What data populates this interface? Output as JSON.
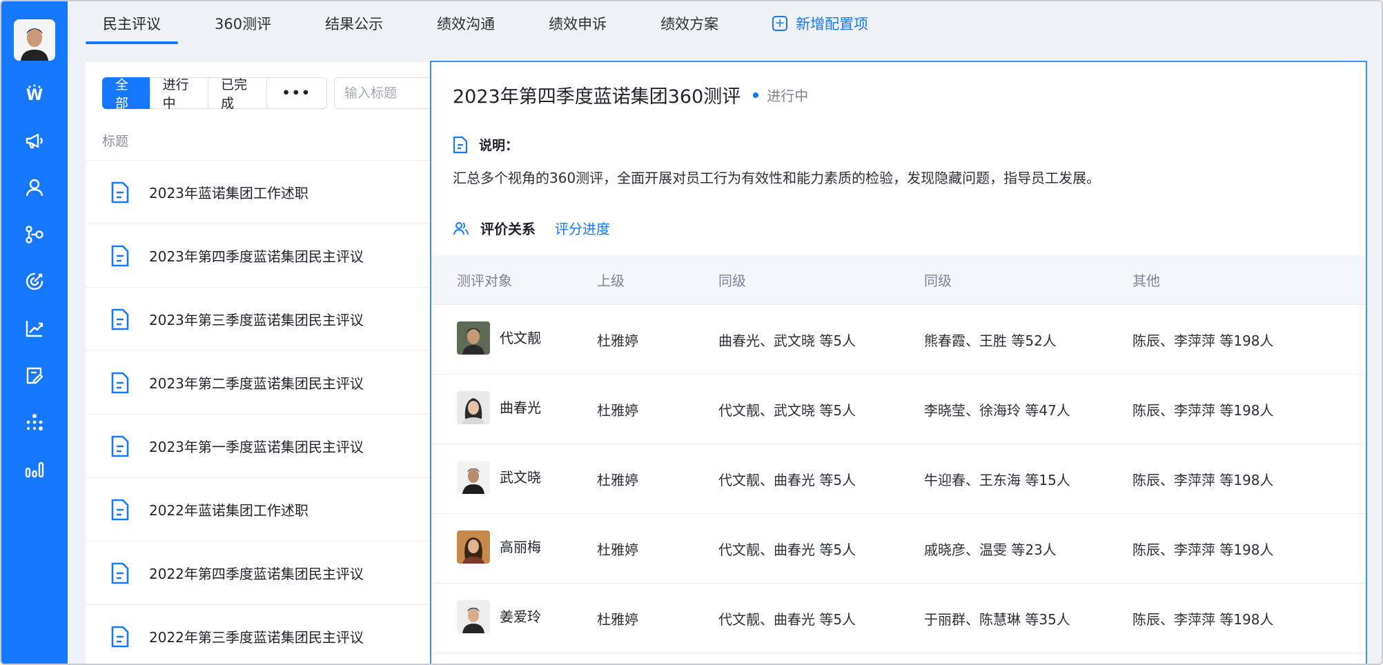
{
  "tabs": [
    {
      "label": "民主评议"
    },
    {
      "label": "360测评"
    },
    {
      "label": "结果公示"
    },
    {
      "label": "绩效沟通"
    },
    {
      "label": "绩效申诉"
    },
    {
      "label": "绩效方案"
    }
  ],
  "add_tab_label": "新增配置项",
  "accent_color": "#1677ff",
  "rail": {
    "icons": [
      "avatar",
      "wordmark-icon",
      "megaphone-icon",
      "user-icon",
      "org-chart-icon",
      "target-icon",
      "trend-chart-icon",
      "doc-edit-icon",
      "dots-network-icon",
      "bar-chart-icon"
    ]
  },
  "filter": {
    "all": "全部",
    "in_progress": "进行中",
    "done": "已完成",
    "more": "•••",
    "search_placeholder": "输入标题"
  },
  "list": {
    "column_header": "标题",
    "items": [
      "2023年蓝诺集团工作述职",
      "2023年第四季度蓝诺集团民主评议",
      "2023年第三季度蓝诺集团民主评议",
      "2023年第二季度蓝诺集团民主评议",
      "2023年第一季度蓝诺集团民主评议",
      "2022年蓝诺集团工作述职",
      "2022年第四季度蓝诺集团民主评议",
      "2022年第三季度蓝诺集团民主评议"
    ]
  },
  "detail": {
    "title": "2023年第四季度蓝诺集团360测评",
    "status": "进行中",
    "desc_label": "说明：",
    "desc_text": "汇总多个视角的360测评，全面开展对员工行为有效性和能力素质的检验，发现隐藏问题，指导员工发展。",
    "tab_relation": "评价关系",
    "tab_progress": "评分进度",
    "table": {
      "headers": [
        "测评对象",
        "上级",
        "同级",
        "同级",
        "其他"
      ],
      "rows": [
        {
          "name": "代文靓",
          "superior": "杜雅婷",
          "peer1": "曲春光、武文晓 等5人",
          "peer2": "熊春霞、王胜 等52人",
          "other": "陈辰、李萍萍 等198人"
        },
        {
          "name": "曲春光",
          "superior": "杜雅婷",
          "peer1": "代文靓、武文晓 等5人",
          "peer2": "李晓莹、徐海玲 等47人",
          "other": "陈辰、李萍萍 等198人"
        },
        {
          "name": "武文晓",
          "superior": "杜雅婷",
          "peer1": "代文靓、曲春光 等5人",
          "peer2": "牛迎春、王东海 等15人",
          "other": "陈辰、李萍萍 等198人"
        },
        {
          "name": "高丽梅",
          "superior": "杜雅婷",
          "peer1": "代文靓、曲春光 等5人",
          "peer2": "戚晓彦、温雯 等23人",
          "other": "陈辰、李萍萍 等198人"
        },
        {
          "name": "姜爱玲",
          "superior": "杜雅婷",
          "peer1": "代文靓、曲春光 等5人",
          "peer2": "于丽群、陈慧琳 等35人",
          "other": "陈辰、李萍萍 等198人"
        }
      ]
    }
  }
}
